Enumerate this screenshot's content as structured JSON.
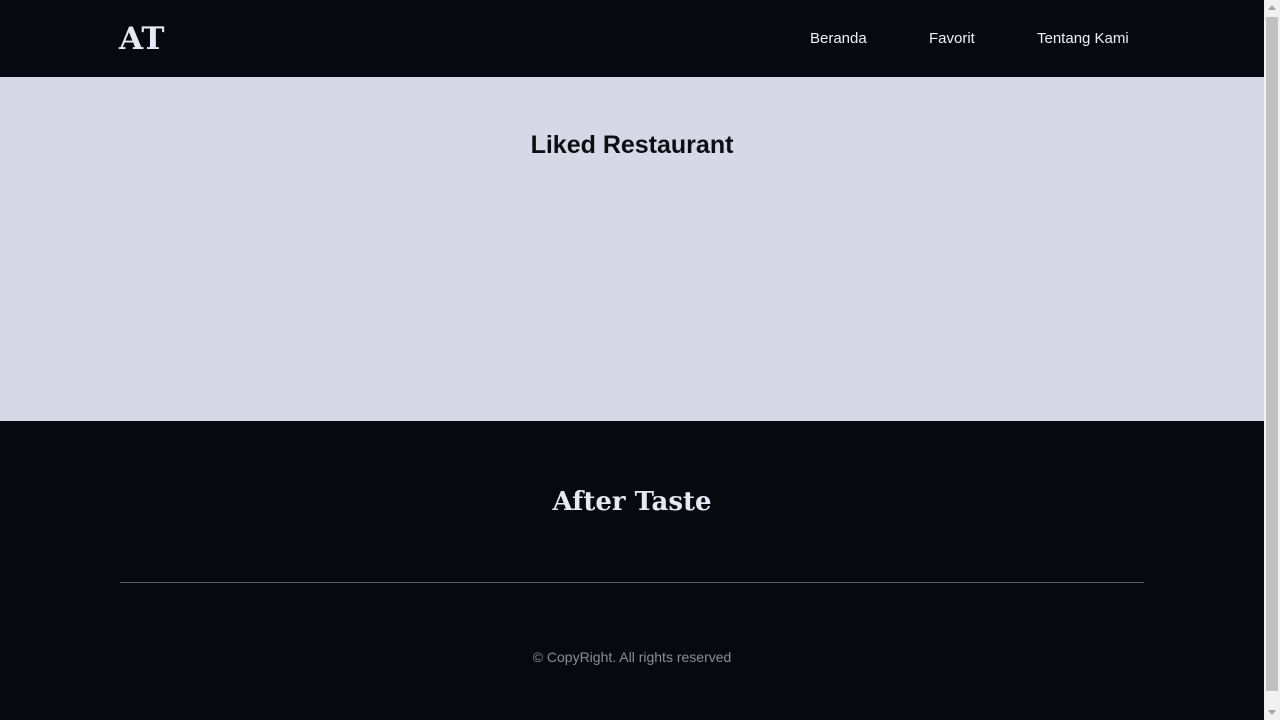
{
  "header": {
    "logo_text": "AT",
    "nav": [
      {
        "label": "Beranda"
      },
      {
        "label": "Favorit"
      },
      {
        "label": "Tentang Kami"
      }
    ]
  },
  "main": {
    "title": "Liked Restaurant"
  },
  "footer": {
    "brand": "After Taste",
    "copyright": "© CopyRight. All rights reserved"
  },
  "colors": {
    "header_bg": "#060910",
    "main_bg": "#d6d8e5",
    "footer_bg": "#060910",
    "text_light": "#e6e9f4",
    "text_dark": "#0c0e15",
    "text_muted": "#8a8e98"
  }
}
